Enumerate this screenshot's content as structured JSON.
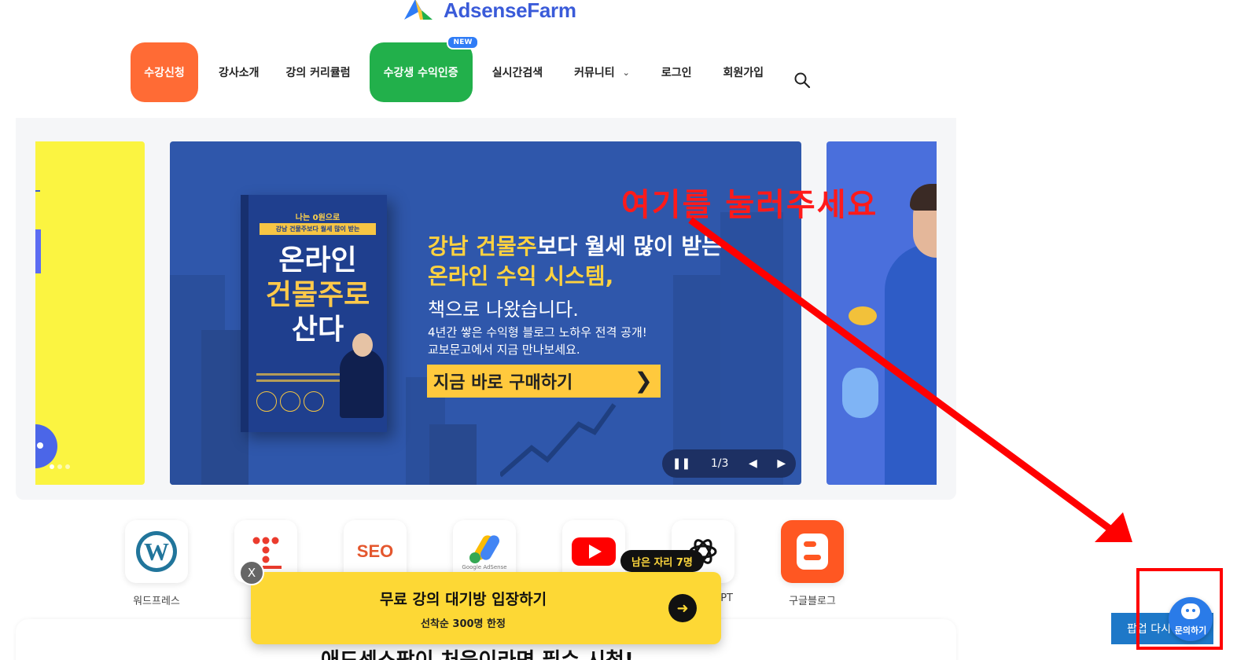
{
  "logo": {
    "text": "AdsenseFarm",
    "icon": "logo-icon"
  },
  "nav": {
    "items": [
      {
        "label": "수강신청",
        "style": "orange-button"
      },
      {
        "label": "강사소개"
      },
      {
        "label": "강의 커리큘럼"
      },
      {
        "label": "수강생 수익인증",
        "style": "green-button",
        "badge": "NEW"
      },
      {
        "label": "실시간검색"
      },
      {
        "label": "커뮤니티",
        "icon": "chevron-down-icon"
      },
      {
        "label": "로그인"
      },
      {
        "label": "회원가입"
      }
    ],
    "search_icon": "search-icon"
  },
  "slider": {
    "book": {
      "top": "나는 0원으로",
      "sub": "강남 건물주보다 월세 많이 받는",
      "t1": "온라인",
      "t2": "건물주로",
      "t3": "산다"
    },
    "headline1_yellow": "강남 건물주",
    "headline1_white": "보다 월세 많이 받는",
    "headline2": "온라인 수익 시스템,",
    "headline3": "책으로 나왔습니다.",
    "desc1": "4년간 쌓은 수익형 블로그 노하우 전격 공개!",
    "desc2": "교보문고에서 지금 만나보세요.",
    "cta": "지금 바로 구매하기",
    "counter": "1/3",
    "controls": {
      "pause": "pause-icon",
      "prev": "prev-icon",
      "next": "next-icon"
    }
  },
  "categories": [
    {
      "label": "워드프레스",
      "icon": "wordpress-icon"
    },
    {
      "label": "T",
      "icon": "tistory-icon"
    },
    {
      "label": "",
      "icon": "seo-icon"
    },
    {
      "label": "",
      "icon": "google-adsense-icon"
    },
    {
      "label": "",
      "icon": "youtube-icon"
    },
    {
      "label": "GPT",
      "icon": "chatgpt-icon"
    },
    {
      "label": "구글블로그",
      "icon": "blogger-icon"
    }
  ],
  "seo_text": "SEO",
  "adsense_caption": "Google AdSense",
  "popup": {
    "title": "무료 강의 대기방 입장하기",
    "sub": "선착순 300명 한정",
    "seat_badge": "남은 자리 7명",
    "close": "X",
    "go_icon": "arrow-right-icon"
  },
  "bottom_title": "애드센스팜이 처음이라면 필수 시청!",
  "popup_again": "팝업 다시",
  "inquiry": {
    "label": "문의하기",
    "icon": "chat-mascot-icon"
  },
  "annotation": {
    "text": "여기를 눌러주세요",
    "color": "#ff0000"
  },
  "colors": {
    "orange": "#ff6b35",
    "green": "#22b04b",
    "slide_blue": "#2f57ab",
    "cta_yellow": "#ffc93d",
    "popup_yellow": "#fdd835",
    "inquiry_blue": "#2a7be8"
  }
}
